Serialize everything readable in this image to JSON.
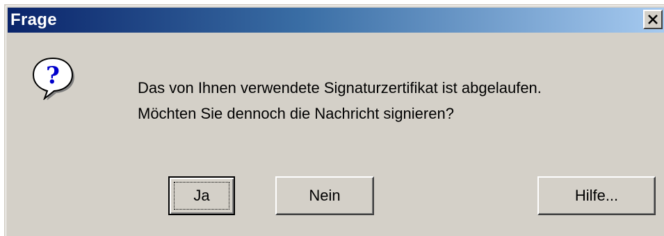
{
  "window": {
    "title": "Frage",
    "close_glyph": "✕"
  },
  "icon": "question-icon",
  "message": {
    "line1": "Das von Ihnen verwendete Signaturzertifikat ist abgelaufen.",
    "line2": "Möchten Sie dennoch die Nachricht signieren?"
  },
  "buttons": {
    "yes": "Ja",
    "no": "Nein",
    "help": "Hilfe..."
  },
  "colors": {
    "titlebar_start": "#0a246a",
    "titlebar_end": "#a6caf0",
    "dialog_bg": "#d4d0c8"
  }
}
